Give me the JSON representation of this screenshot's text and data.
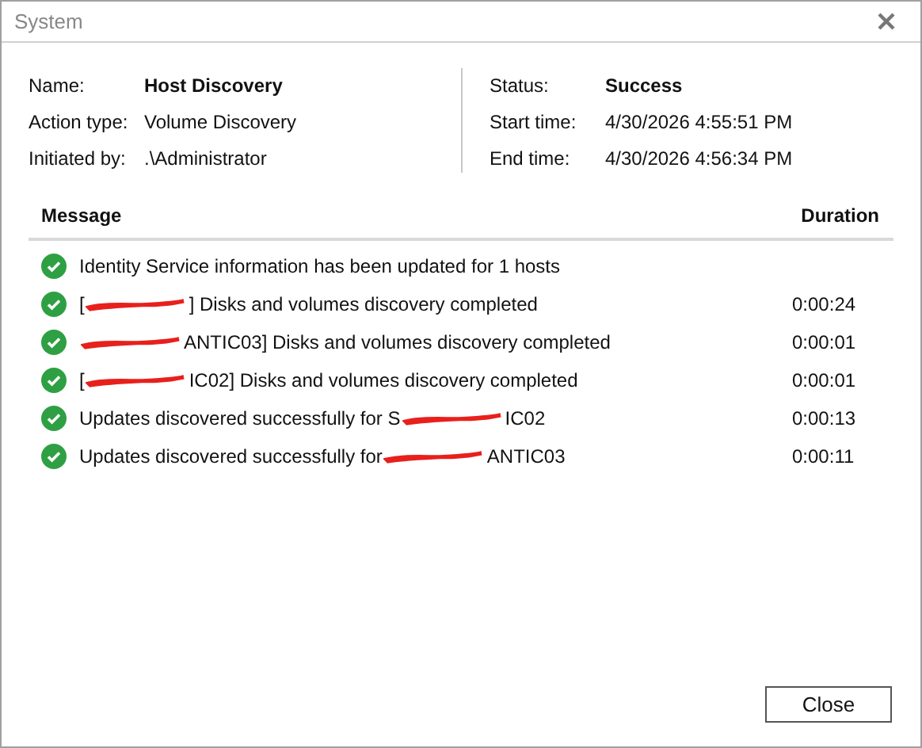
{
  "window": {
    "title": "System"
  },
  "details": {
    "left": [
      {
        "label": "Name:",
        "value": "Host Discovery",
        "bold": true
      },
      {
        "label": "Action type:",
        "value": "Volume Discovery",
        "bold": false
      },
      {
        "label": "Initiated by:",
        "value": ".\\Administrator",
        "bold": false
      }
    ],
    "right": [
      {
        "label": "Status:",
        "value": "Success",
        "bold": true
      },
      {
        "label": "Start time:",
        "value": "4/30/2026 4:55:51 PM",
        "bold": false
      },
      {
        "label": "End time:",
        "value": "4/30/2026 4:56:34 PM",
        "bold": false
      }
    ]
  },
  "table": {
    "columns": [
      "Message",
      "Duration"
    ],
    "rows": [
      {
        "kind": "success",
        "before": "Identity Service information has been updated for 1 hosts",
        "redacted": false,
        "after": ""
      },
      {
        "kind": "success",
        "before": "[",
        "redacted": true,
        "after": "] Disks and volumes discovery completed",
        "duration": "0:00:24"
      },
      {
        "kind": "success",
        "before": "",
        "redacted": true,
        "after": "ANTIC03] Disks and volumes discovery completed",
        "duration": "0:00:01"
      },
      {
        "kind": "success",
        "before": "[",
        "redacted": true,
        "after": "IC02] Disks and volumes discovery completed",
        "duration": "0:00:01"
      },
      {
        "kind": "success",
        "before": "Updates discovered successfully for S",
        "redacted": true,
        "after": "IC02",
        "duration": "0:00:13"
      },
      {
        "kind": "success",
        "before": "Updates discovered successfully for",
        "redacted": true,
        "after": "ANTIC03",
        "duration": "0:00:11"
      }
    ]
  },
  "buttons": [
    "Close"
  ]
}
